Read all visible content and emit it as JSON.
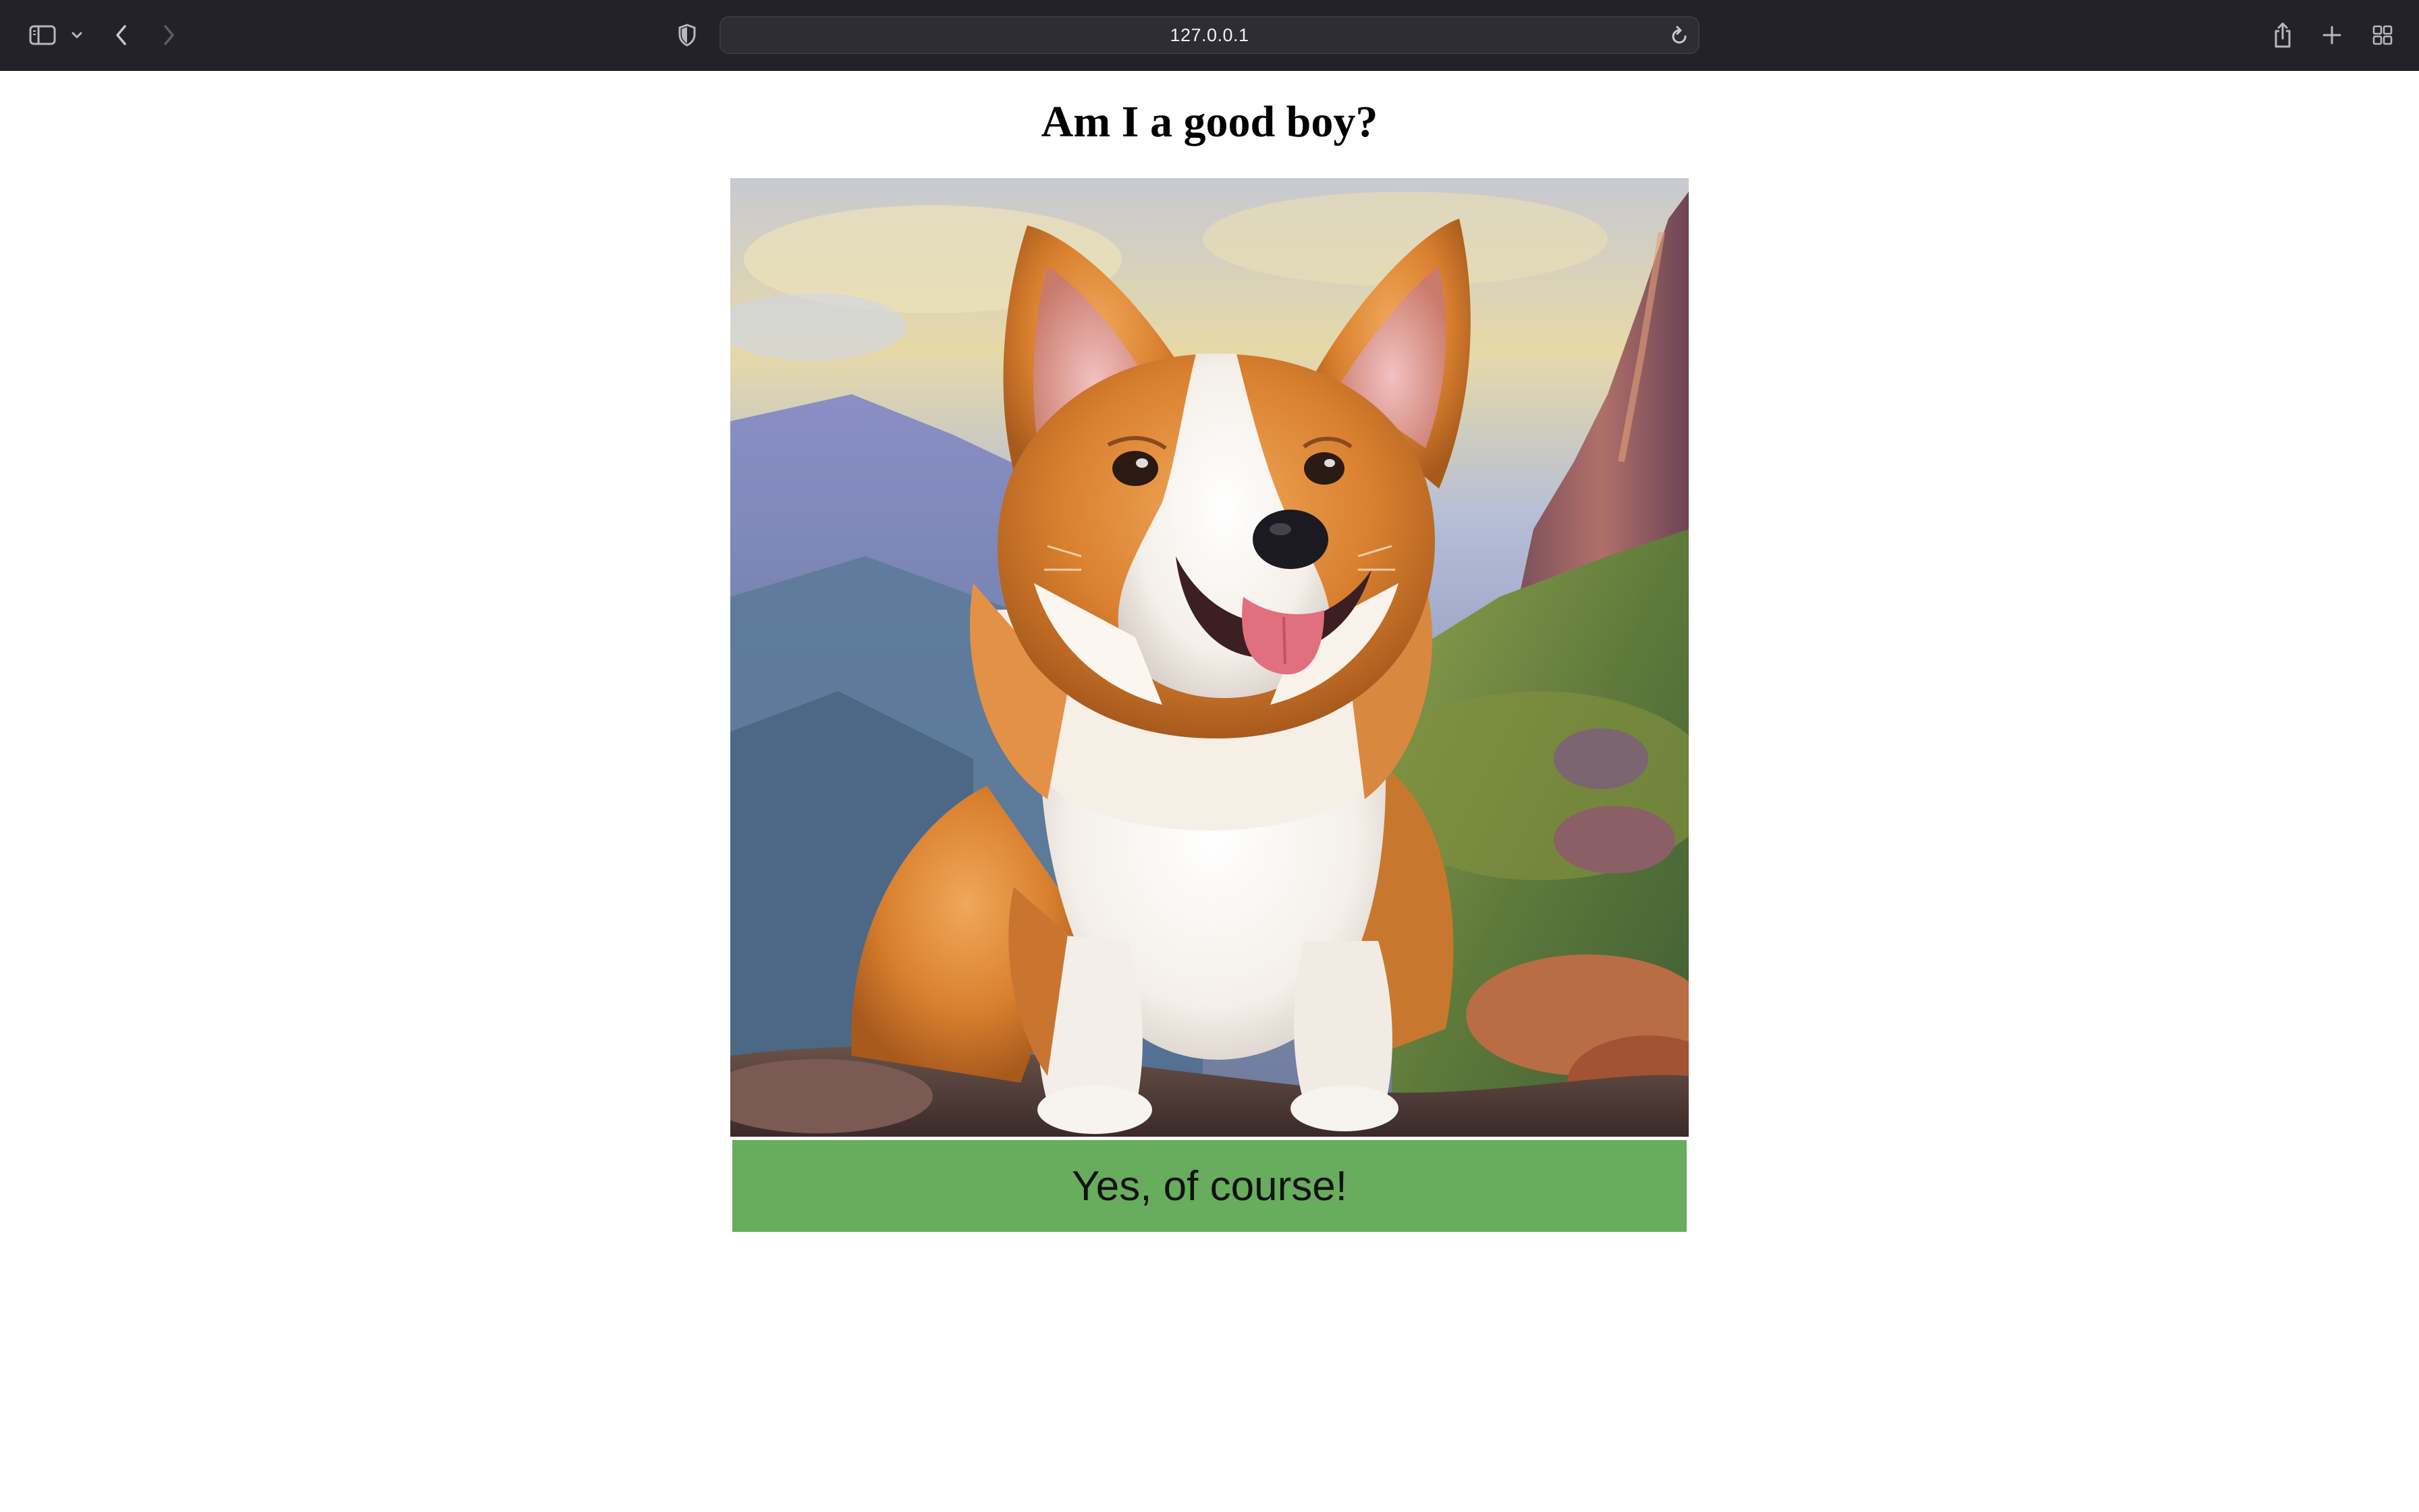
{
  "browser": {
    "url": "127.0.0.1",
    "icons": {
      "sidebar": "sidebar-icon",
      "chevron": "chevron-down-icon",
      "back": "back-icon",
      "forward": "forward-icon",
      "privacy": "shield-icon",
      "reload": "reload-icon",
      "share": "share-icon",
      "new_tab": "plus-icon",
      "tabs": "tab-overview-icon"
    },
    "colors": {
      "toolbar": "#232129",
      "address_bar": "#2e2c34"
    }
  },
  "page": {
    "title": "Am I a good boy?",
    "answer_button": "Yes, of course!",
    "colors": {
      "button": "#68ac5d",
      "background": "#ffffff"
    }
  }
}
